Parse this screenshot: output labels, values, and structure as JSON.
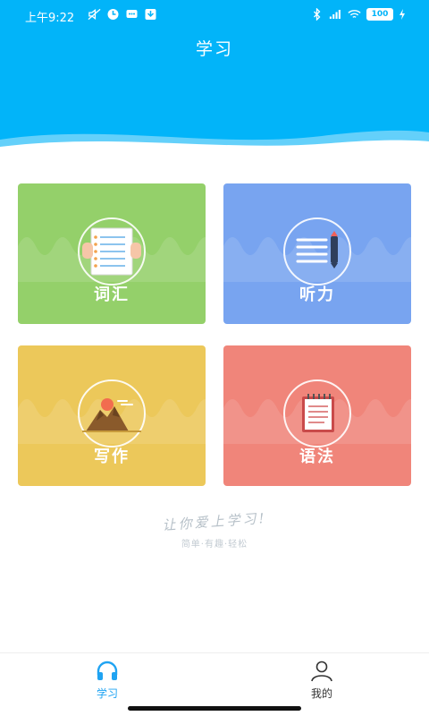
{
  "status_bar": {
    "time": "上午9:22",
    "battery": "100"
  },
  "header": {
    "title": "学习"
  },
  "cards": [
    {
      "label": "词汇",
      "color": "#94d06a",
      "icon": "vocabulary-book-icon"
    },
    {
      "label": "听力",
      "color": "#78a4f0",
      "icon": "listening-notes-icon"
    },
    {
      "label": "写作",
      "color": "#ecc85a",
      "icon": "writing-mountain-icon"
    },
    {
      "label": "语法",
      "color": "#f0857a",
      "icon": "grammar-notebook-icon"
    }
  ],
  "slogan": {
    "main": "让你爱上学习!",
    "sub": "简单·有趣·轻松"
  },
  "bottom_nav": {
    "items": [
      {
        "label": "学习",
        "icon": "headphones-icon",
        "active": true
      },
      {
        "label": "我的",
        "icon": "user-icon",
        "active": false
      }
    ]
  },
  "colors": {
    "header": "#02b4f9",
    "accent": "#1fa3f2"
  }
}
